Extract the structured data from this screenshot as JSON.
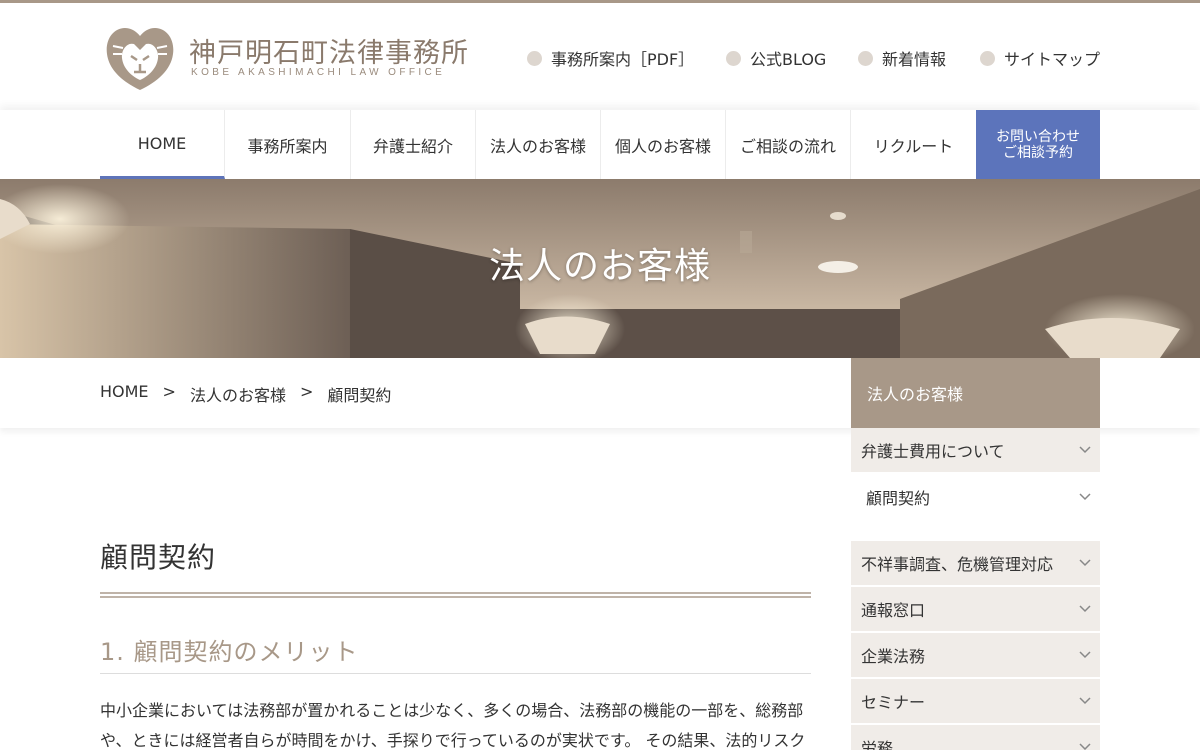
{
  "header": {
    "logo_title": "神戸明石町法律事務所",
    "logo_subtitle": "KOBE AKASHIMACHI LAW OFFICE",
    "util_links": [
      "事務所案内［PDF］",
      "公式BLOG",
      "新着情報",
      "サイトマップ"
    ]
  },
  "nav": {
    "items": [
      "HOME",
      "事務所案内",
      "弁護士紹介",
      "法人のお客様",
      "個人のお客様",
      "ご相談の流れ",
      "リクルート"
    ],
    "active": "HOME",
    "contact_line1": "お問い合わせ",
    "contact_line2": "ご相談予約"
  },
  "hero": {
    "title": "法人のお客様"
  },
  "breadcrumb": [
    "HOME",
    ">",
    "法人のお客様",
    ">",
    "顧問契約"
  ],
  "sidebar": {
    "heading": "法人のお客様",
    "items": [
      "弁護士費用について",
      "顧問契約",
      "不祥事調査、危機管理対応",
      "通報窓口",
      "企業法務",
      "セミナー",
      "労務"
    ]
  },
  "main": {
    "page_title": "顧問契約",
    "section_title": "1. 顧問契約のメリット",
    "paragraph": "中小企業においては法務部が置かれることは少なく、多くの場合、法務部の機能の一部を、総務部や、ときには経営者自らが時間をかけ、手探りで行っているのが実状です。 その結果、法的リスク"
  },
  "colors": {
    "accent_blue": "#5c74bb",
    "brand_taupe": "#a89888",
    "side_bg": "#f0ece8"
  }
}
